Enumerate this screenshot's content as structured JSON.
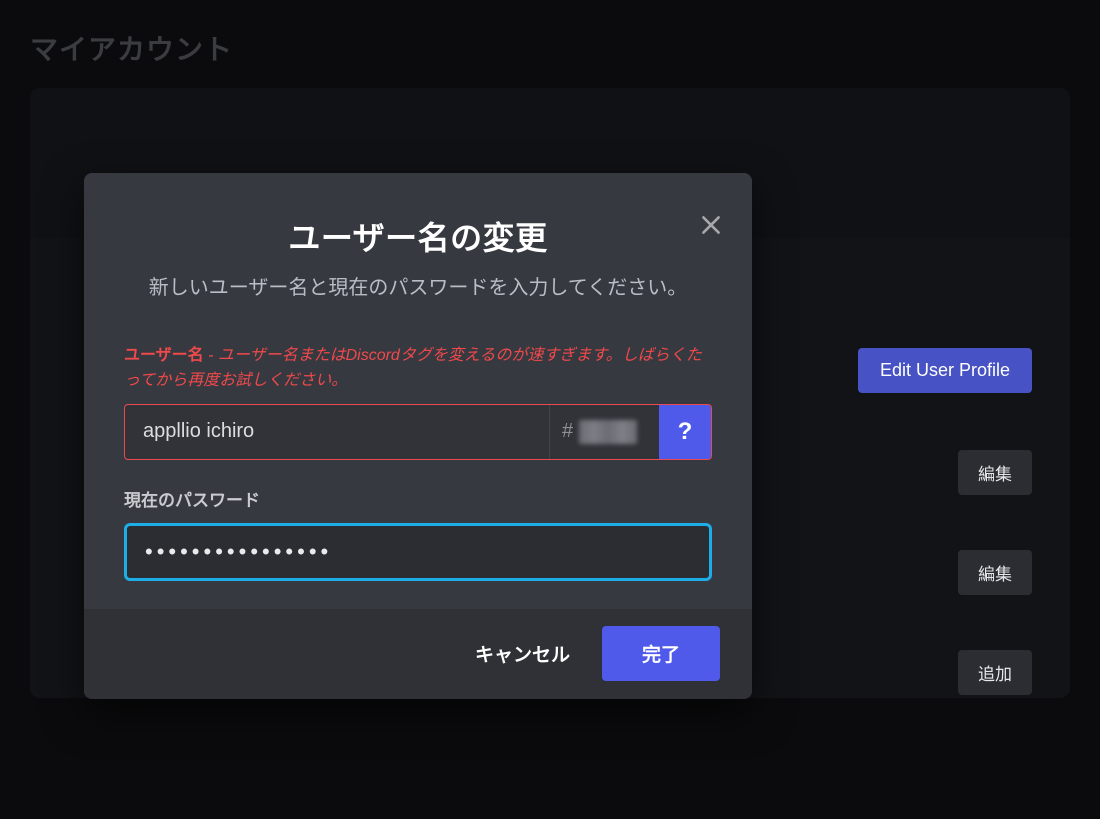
{
  "page": {
    "title": "マイアカウント",
    "edit_profile_btn": "Edit User Profile",
    "edit_btn": "編集",
    "add_btn": "追加"
  },
  "modal": {
    "title": "ユーザー名の変更",
    "subtitle": "新しいユーザー名と現在のパスワードを入力してください。",
    "error_label": "ユーザー名",
    "error_dash": " - ",
    "error_msg": "ユーザー名またはDiscordタグを変えるのが速すぎます。しばらくたってから再度お試しください。",
    "username_value": "appllio ichiro",
    "tag_hash": "#",
    "help_label": "?",
    "password_label": "現在のパスワード",
    "password_value": "••••••••••••••••",
    "cancel": "キャンセル",
    "done": "完了"
  },
  "colors": {
    "accent": "#4f5aea",
    "error": "#e94a4e",
    "focus": "#1daee8"
  }
}
